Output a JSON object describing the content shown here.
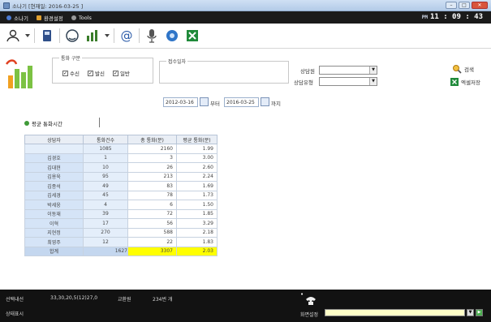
{
  "window": {
    "title": "소나기 [현재일: 2016-03-25 ]",
    "min": "–",
    "max": "□",
    "close": "✕"
  },
  "menu": {
    "items": [
      "소나기",
      "환경설정",
      "Tools"
    ],
    "ampm": "PM",
    "time": "11 : 09 : 43"
  },
  "toolbar": {
    "icons": [
      "person-icon",
      "phone-book-icon",
      "headset-icon",
      "bar-chart-icon",
      "at-icon",
      "microphone-icon",
      "refresh-globe-icon",
      "excel-icon"
    ]
  },
  "filter": {
    "call_type_legend": "통화 구분",
    "call_types": [
      {
        "label": "수신",
        "checked": true
      },
      {
        "label": "발신",
        "checked": true
      },
      {
        "label": "일반",
        "checked": true
      }
    ],
    "date_legend": "접수일자",
    "date_from": "2012-03-16",
    "from_suffix": "부터",
    "date_to": "2016-03-25",
    "to_suffix": "까지",
    "agent_label": "상담원",
    "agent_value": "",
    "type_label": "상담유형",
    "type_value": "",
    "search_label": "검색",
    "excel_label": "엑셀저장"
  },
  "tab": {
    "label": "평균 통화시간"
  },
  "table": {
    "headers": [
      "상담자",
      "통화건수",
      "총 통화(분)",
      "평균 통화(분)"
    ],
    "rows": [
      [
        "",
        "1085",
        "2160",
        "1.99"
      ],
      [
        "김경호",
        "1",
        "3",
        "3.00"
      ],
      [
        "김대현",
        "10",
        "26",
        "2.60"
      ],
      [
        "김용욱",
        "95",
        "213",
        "2.24"
      ],
      [
        "김종석",
        "49",
        "83",
        "1.69"
      ],
      [
        "김세경",
        "45",
        "78",
        "1.73"
      ],
      [
        "박세웅",
        "4",
        "6",
        "1.50"
      ],
      [
        "이동재",
        "39",
        "72",
        "1.85"
      ],
      [
        "이혁",
        "17",
        "56",
        "3.29"
      ],
      [
        "지현정",
        "270",
        "588",
        "2.18"
      ],
      [
        "최영주",
        "12",
        "22",
        "1.83"
      ]
    ],
    "total": [
      "합계",
      "1627",
      "3307",
      "2.03"
    ]
  },
  "status": {
    "line1": [
      "선택내선",
      "33,30,20,5(12)27,0",
      "교환원",
      "234번 개"
    ],
    "line2": "상태표시",
    "phone_label": "화면설정"
  },
  "colors": {
    "highlight": "#ffff00",
    "statusbar": "#121212",
    "menubar": "#1b1b1b",
    "name_cell": "#d5e4f7"
  }
}
